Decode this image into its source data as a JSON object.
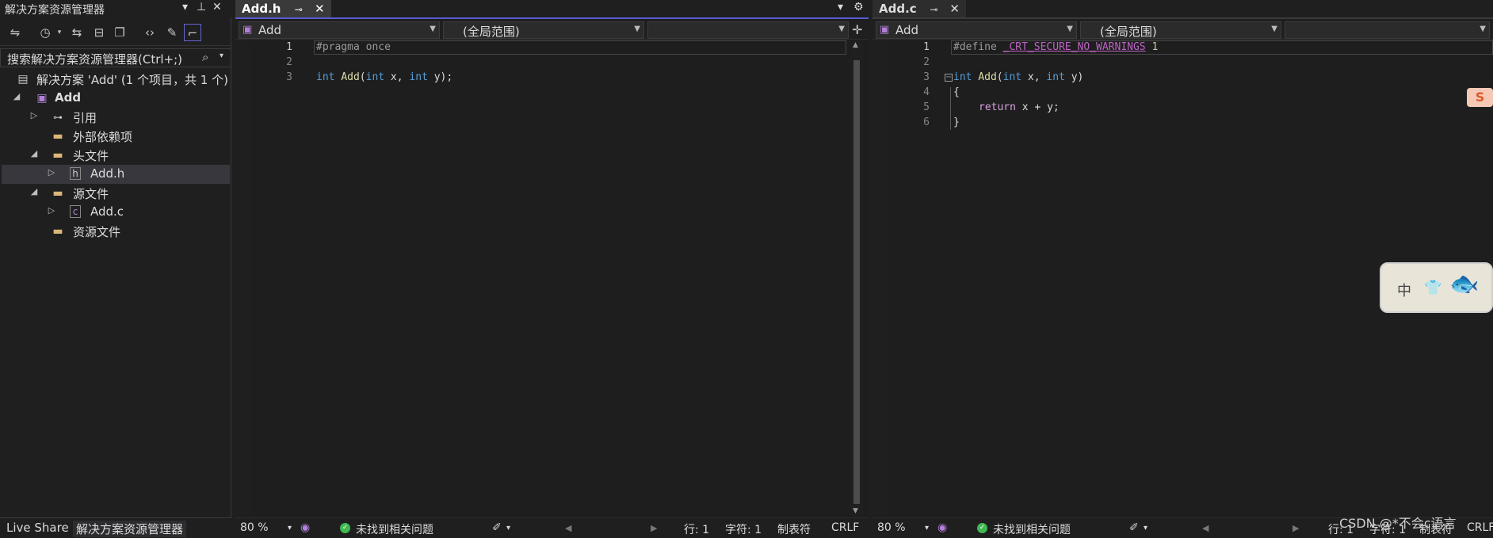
{
  "solution_explorer": {
    "title": "解决方案资源管理器",
    "search_placeholder": "搜索解决方案资源管理器(Ctrl+;)",
    "tree": [
      {
        "label": "解决方案 'Add' (1 个项目，共 1 个)"
      },
      {
        "label": "Add"
      },
      {
        "label": "引用"
      },
      {
        "label": "外部依赖项"
      },
      {
        "label": "头文件"
      },
      {
        "label": "Add.h"
      },
      {
        "label": "源文件"
      },
      {
        "label": "Add.c"
      },
      {
        "label": "资源文件"
      }
    ],
    "bottom_tabs": [
      "Live Share",
      "解决方案资源管理器"
    ]
  },
  "editor1": {
    "tab_label": "Add.h",
    "project_combo": "Add",
    "scope_combo": "(全局范围)",
    "line_numbers": [
      "1",
      "2",
      "3"
    ],
    "code": {
      "l1": "#pragma once",
      "l3_int1": "int",
      "l3_fn": "Add",
      "l3_paren": "(",
      "l3_int2": "int",
      "l3_x": " x, ",
      "l3_int3": "int",
      "l3_rest": " y);"
    },
    "status": {
      "zoom": "80 %",
      "issues": "未找到相关问题",
      "line": "行: 1",
      "char": "字符: 1",
      "indent": "制表符",
      "eol": "CRLF"
    }
  },
  "editor2": {
    "tab_label": "Add.c",
    "project_combo": "Add",
    "scope_combo": "(全局范围)",
    "line_numbers": [
      "1",
      "2",
      "3",
      "4",
      "5",
      "6"
    ],
    "code": {
      "l1_define": "#define",
      "l1_macro": "_CRT_SECURE_NO_WARNINGS",
      "l1_num": "1",
      "l3_int1": "int",
      "l3_fn": "Add",
      "l3_p": "(",
      "l3_int2": "int",
      "l3_x": " x, ",
      "l3_int3": "int",
      "l3_rest": " y)",
      "l4": "{",
      "l5_ret": "return",
      "l5_rest": " x + y;",
      "l6": "}"
    },
    "status": {
      "zoom": "80 %",
      "issues": "未找到相关问题",
      "line": "行: 1",
      "char": "字符: 1",
      "indent": "制表符",
      "eol": "CRLF"
    }
  },
  "overlays": {
    "widget_text": "中",
    "s_logo": "S",
    "watermark": "CSDN @*不会c语言"
  }
}
